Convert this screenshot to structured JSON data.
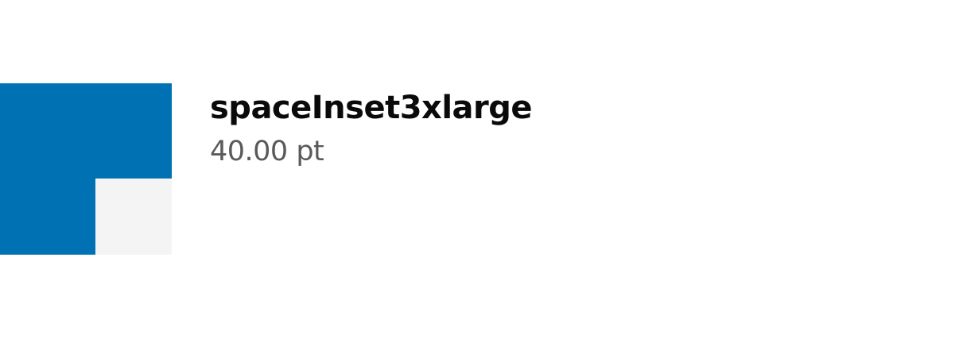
{
  "token": {
    "name": "spaceInset3xlarge",
    "value": "40.00 pt"
  },
  "colors": {
    "swatch_outer": "#0072b3",
    "swatch_inner": "#f4f4f4",
    "name_text": "#0a0a0a",
    "value_text": "#5a5a5a"
  }
}
